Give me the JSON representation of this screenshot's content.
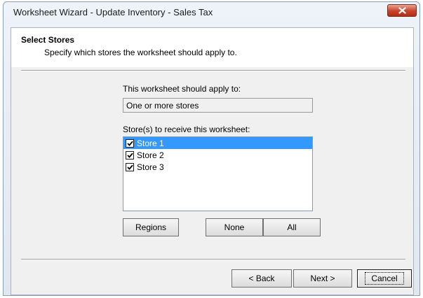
{
  "window": {
    "title": "Worksheet Wizard - Update Inventory - Sales Tax"
  },
  "header": {
    "title": "Select Stores",
    "subtitle": "Specify which stores the worksheet should apply to."
  },
  "apply_to": {
    "label": "This worksheet should apply to:",
    "value": "One or more stores"
  },
  "stores": {
    "label": "Store(s) to receive this worksheet:",
    "items": [
      {
        "label": "Store 1",
        "checked": true,
        "selected": true
      },
      {
        "label": "Store 2",
        "checked": true,
        "selected": false
      },
      {
        "label": "Store 3",
        "checked": true,
        "selected": false
      }
    ]
  },
  "selection_buttons": {
    "regions": "Regions",
    "none": "None",
    "all": "All"
  },
  "nav_buttons": {
    "back": "< Back",
    "next": "Next >",
    "cancel": "Cancel"
  },
  "colors": {
    "selection": "#3399ff",
    "close_button": "#c8432a"
  }
}
